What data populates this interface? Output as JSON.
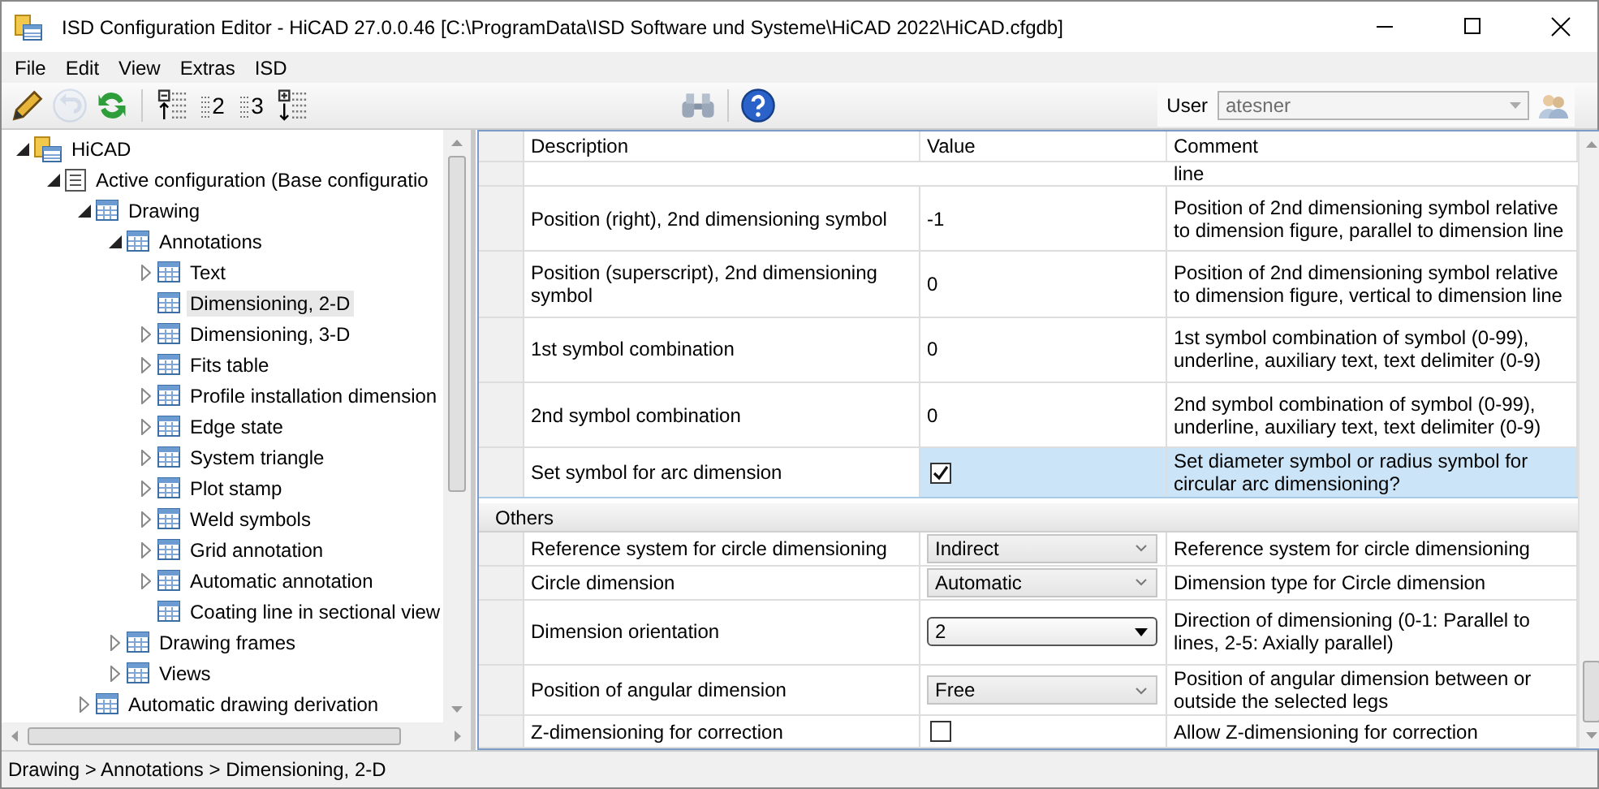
{
  "window": {
    "title": "ISD Configuration Editor  - HiCAD 27.0.0.46 [C:\\ProgramData\\ISD Software und Systeme\\HiCAD 2022\\HiCAD.cfgdb]"
  },
  "menu": [
    "File",
    "Edit",
    "View",
    "Extras",
    "ISD"
  ],
  "toolbar": {
    "tools": [
      {
        "kind": "pencil",
        "disabled": false
      },
      {
        "kind": "undo",
        "disabled": true
      },
      {
        "kind": "refresh",
        "disabled": false
      },
      {
        "kind": "sep"
      },
      {
        "kind": "collapse",
        "disabled": false
      },
      {
        "kind": "level",
        "label": "2",
        "disabled": false
      },
      {
        "kind": "level",
        "label": "3",
        "disabled": false
      },
      {
        "kind": "expand",
        "disabled": false
      }
    ],
    "user_label": "User",
    "user_value": "atesner"
  },
  "tree": [
    {
      "label": "HiCAD",
      "kind": "node",
      "expanded": true,
      "selected": false,
      "children": [
        {
          "label": "Active configuration (Base configuratio",
          "kind": "node",
          "expanded": true,
          "selected": false,
          "children": [
            {
              "label": "Drawing",
              "kind": "node",
              "expanded": true,
              "selected": false,
              "children": [
                {
                  "label": "Annotations",
                  "kind": "node",
                  "expanded": true,
                  "selected": false,
                  "children": [
                    {
                      "label": "Text",
                      "kind": "node",
                      "expanded": false,
                      "selected": false
                    },
                    {
                      "label": "Dimensioning, 2-D",
                      "kind": "leaf",
                      "selected": true
                    },
                    {
                      "label": "Dimensioning, 3-D",
                      "kind": "node",
                      "expanded": false,
                      "selected": false
                    },
                    {
                      "label": "Fits table",
                      "kind": "node",
                      "expanded": false,
                      "selected": false
                    },
                    {
                      "label": "Profile installation dimension",
                      "kind": "node",
                      "expanded": false,
                      "selected": false
                    },
                    {
                      "label": "Edge state",
                      "kind": "node",
                      "expanded": false,
                      "selected": false
                    },
                    {
                      "label": "System triangle",
                      "kind": "node",
                      "expanded": false,
                      "selected": false
                    },
                    {
                      "label": "Plot stamp",
                      "kind": "node",
                      "expanded": false,
                      "selected": false
                    },
                    {
                      "label": "Weld symbols",
                      "kind": "node",
                      "expanded": false,
                      "selected": false
                    },
                    {
                      "label": "Grid annotation",
                      "kind": "node",
                      "expanded": false,
                      "selected": false
                    },
                    {
                      "label": "Automatic annotation",
                      "kind": "node",
                      "expanded": false,
                      "selected": false
                    },
                    {
                      "label": "Coating line in sectional view",
                      "kind": "leaf",
                      "selected": false
                    }
                  ]
                },
                {
                  "label": "Drawing frames",
                  "kind": "node",
                  "expanded": false,
                  "selected": false
                },
                {
                  "label": "Views",
                  "kind": "node",
                  "expanded": false,
                  "selected": false
                }
              ]
            },
            {
              "label": "Automatic drawing derivation",
              "kind": "node",
              "expanded": false,
              "selected": false
            }
          ]
        }
      ]
    }
  ],
  "grid": {
    "columns": [
      "Description",
      "Value",
      "Comment"
    ],
    "clipped_comment": "line",
    "groups": [
      {
        "rows": [
          {
            "description": "Position (right), 2nd dimensioning symbol",
            "kind": "text",
            "value": "-1",
            "comment": "Position of 2nd dimensioning symbol relative to dimension figure, parallel to dimension line",
            "selected": false
          },
          {
            "description": "Position (superscript), 2nd dimensioning symbol",
            "kind": "text",
            "value": "0",
            "comment": "Position of 2nd dimensioning symbol relative to dimension figure, vertical to dimension line",
            "selected": false
          },
          {
            "description": "1st symbol combination",
            "kind": "text",
            "value": "0",
            "comment": "1st symbol combination of symbol (0-99), underline, auxiliary text, text delimiter (0-9)",
            "selected": false
          },
          {
            "description": "2nd symbol combination",
            "kind": "text",
            "value": "0",
            "comment": "2nd symbol combination of symbol (0-99), underline, auxiliary text, text delimiter (0-9)",
            "selected": false
          },
          {
            "description": "Set symbol for arc dimension",
            "kind": "checkbox",
            "checked": true,
            "comment": "Set diameter symbol or radius symbol for circular arc dimensioning?",
            "selected": true
          }
        ]
      },
      {
        "title": "Others",
        "rows": [
          {
            "description": "Reference system for circle dimensioning",
            "kind": "dropdown",
            "value": "Indirect",
            "focused": false,
            "comment": "Reference system for circle dimensioning",
            "selected": false
          },
          {
            "description": "Circle dimension",
            "kind": "dropdown",
            "value": "Automatic",
            "focused": false,
            "comment": "Dimension type for Circle dimension",
            "selected": false
          },
          {
            "description": "Dimension orientation",
            "kind": "dropdown",
            "value": "2",
            "focused": true,
            "comment": "Direction of dimensioning (0-1: Parallel to lines, 2-5: Axially parallel)",
            "selected": false
          },
          {
            "description": "Position of angular dimension",
            "kind": "dropdown",
            "value": "Free",
            "focused": false,
            "comment": "Position of angular dimension between or outside the selected legs",
            "selected": false
          },
          {
            "description": "Z-dimensioning for correction",
            "kind": "checkbox",
            "checked": false,
            "comment": "Allow Z-dimensioning for correction",
            "selected": false
          }
        ]
      }
    ]
  },
  "status_bar": "Drawing > Annotations > Dimensioning, 2-D"
}
